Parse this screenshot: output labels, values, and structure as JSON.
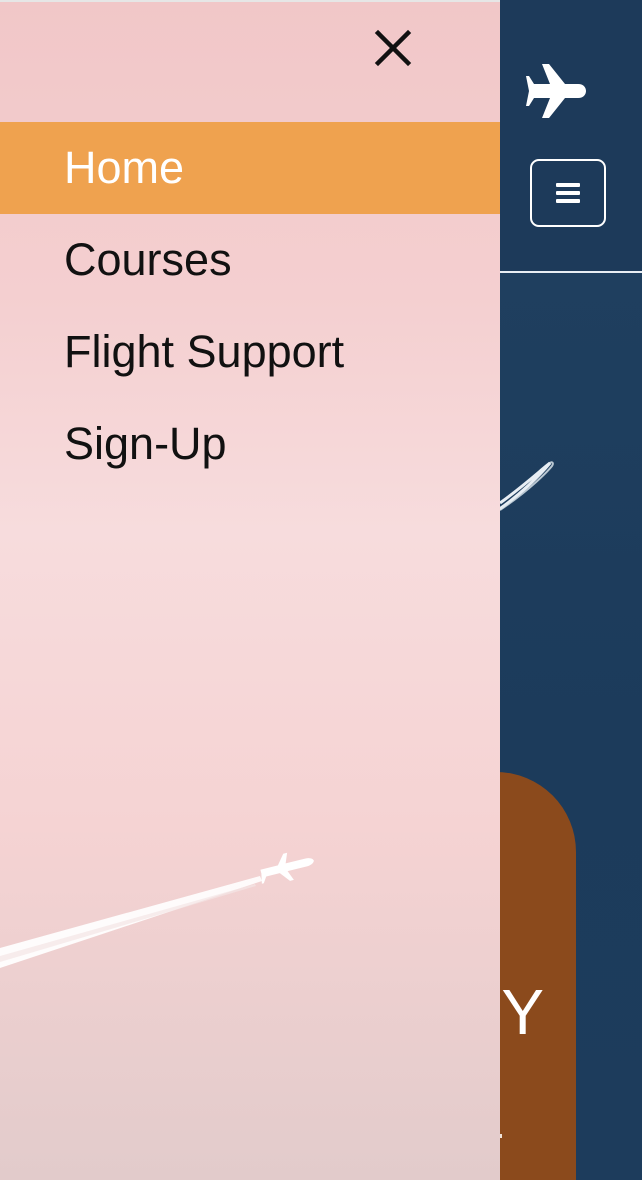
{
  "drawer": {
    "close_label": "×",
    "nav_items": [
      {
        "label": "Home",
        "active": true
      },
      {
        "label": "Courses",
        "active": false
      },
      {
        "label": "Flight Support",
        "active": false
      },
      {
        "label": "Sign-Up",
        "active": false
      }
    ]
  },
  "header": {
    "logo_icon": "airplane-icon",
    "menu_icon": "hamburger-icon"
  },
  "hero": {
    "card_text_fragment": "Y"
  },
  "colors": {
    "navy": "#1d3a5a",
    "active_orange": "#efa24f",
    "card_brown": "#8b4a1c",
    "drawer_pink": "#f4cfd0"
  }
}
